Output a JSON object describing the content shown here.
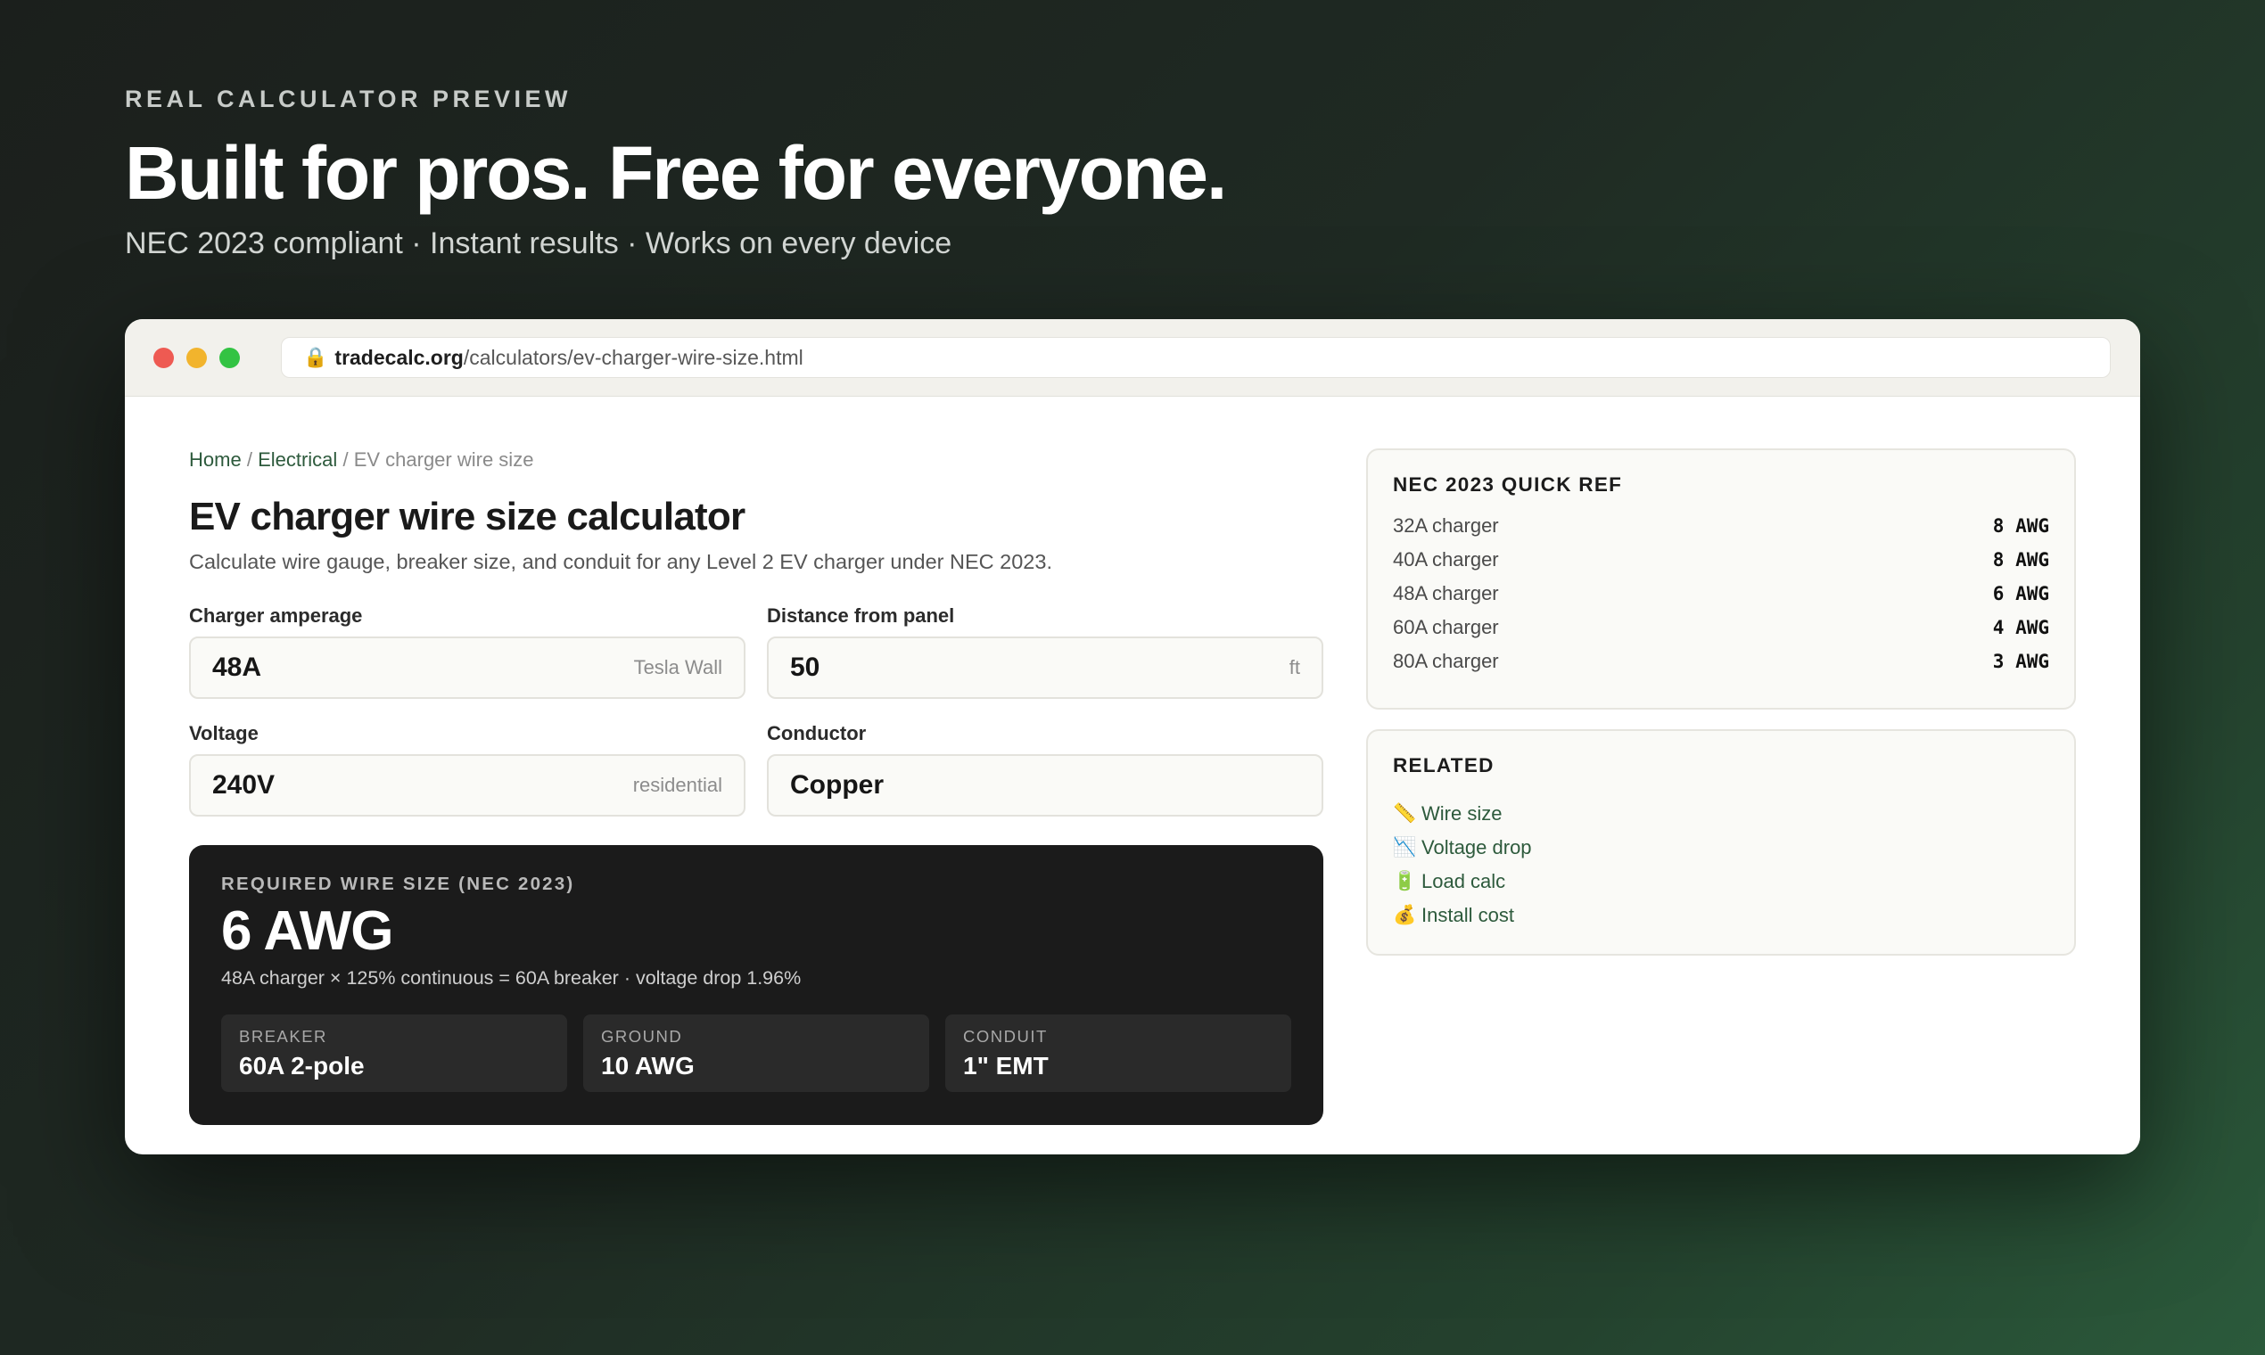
{
  "hero": {
    "eyebrow": "REAL CALCULATOR PREVIEW",
    "headline": "Built for pros. Free for everyone.",
    "subline": "NEC 2023 compliant · Instant results · Works on every device"
  },
  "browser": {
    "url_domain": "tradecalc.org",
    "url_path": "/calculators/ev-charger-wire-size.html"
  },
  "breadcrumb": {
    "home": "Home",
    "sep": "/",
    "electrical": "Electrical",
    "current": "EV charger wire size"
  },
  "page": {
    "title": "EV charger wire size calculator",
    "description": "Calculate wire gauge, breaker size, and conduit for any Level 2 EV charger under NEC 2023."
  },
  "form": {
    "amperage": {
      "label": "Charger amperage",
      "value": "48A",
      "hint": "Tesla Wall"
    },
    "distance": {
      "label": "Distance from panel",
      "value": "50",
      "hint": "ft"
    },
    "voltage": {
      "label": "Voltage",
      "value": "240V",
      "hint": "residential"
    },
    "conductor": {
      "label": "Conductor",
      "value": "Copper"
    }
  },
  "result": {
    "label": "REQUIRED WIRE SIZE (NEC 2023)",
    "value": "6 AWG",
    "detail": "48A charger × 125% continuous = 60A breaker · voltage drop 1.96%",
    "stats": [
      {
        "label": "BREAKER",
        "value": "60A 2-pole"
      },
      {
        "label": "GROUND",
        "value": "10 AWG"
      },
      {
        "label": "CONDUIT",
        "value": "1\" EMT"
      }
    ]
  },
  "quick_ref": {
    "title": "NEC 2023 QUICK REF",
    "rows": [
      {
        "label": "32A charger",
        "value": "8 AWG"
      },
      {
        "label": "40A charger",
        "value": "8 AWG"
      },
      {
        "label": "48A charger",
        "value": "6 AWG"
      },
      {
        "label": "60A charger",
        "value": "4 AWG"
      },
      {
        "label": "80A charger",
        "value": "3 AWG"
      }
    ]
  },
  "related": {
    "title": "RELATED",
    "items": [
      {
        "icon": "📏",
        "label": "Wire size"
      },
      {
        "icon": "📉",
        "label": "Voltage drop"
      },
      {
        "icon": "🔋",
        "label": "Load calc"
      },
      {
        "icon": "💰",
        "label": "Install cost"
      }
    ]
  },
  "colors": {
    "accent_green": "#2d5a3c",
    "result_bg": "#1b1b1b",
    "traffic_red": "#ee5a52",
    "traffic_yellow": "#f2b42d",
    "traffic_green": "#33c343"
  }
}
